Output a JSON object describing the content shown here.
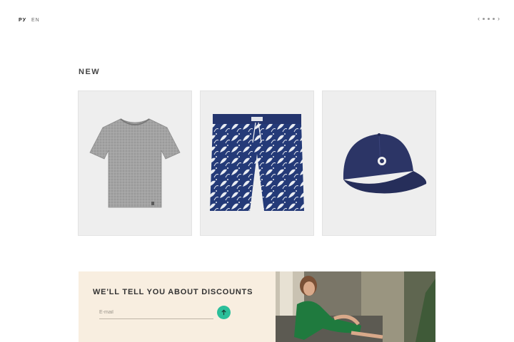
{
  "language": {
    "current": "РУ",
    "other": "EN"
  },
  "slider_nav": {
    "prev_icon": "chevron-left-icon",
    "next_icon": "chevron-right-icon",
    "dots": 3
  },
  "section": {
    "title": "NEW"
  },
  "products": [
    {
      "icon": "tshirt-image",
      "color": "#9a9a9a"
    },
    {
      "icon": "swim-shorts-image",
      "color": "#2a3a6e"
    },
    {
      "icon": "cap-image",
      "color": "#2c3566"
    }
  ],
  "newsletter": {
    "title": "WE'LL TELL YOU ABOUT DISCOUNTS",
    "email_placeholder": "E-mail",
    "submit_icon": "arrow-up-icon",
    "accent": "#2bbf9a",
    "background": "#f8eee0"
  }
}
